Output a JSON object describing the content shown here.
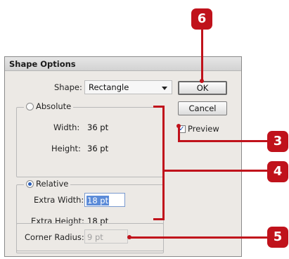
{
  "dialog": {
    "title": "Shape Options",
    "shape_label": "Shape:",
    "shape_value": "Rectangle",
    "ok_label": "OK",
    "cancel_label": "Cancel",
    "preview_label": "Preview",
    "preview_checked": true,
    "absolute": {
      "label": "Absolute",
      "width_label": "Width:",
      "width_value": "36 pt",
      "height_label": "Height:",
      "height_value": "36 pt"
    },
    "relative": {
      "label": "Relative",
      "extra_width_label": "Extra Width:",
      "extra_width_value": "18 pt",
      "extra_height_label": "Extra Height:",
      "extra_height_value": "18 pt"
    },
    "corner_radius_label": "Corner Radius:",
    "corner_radius_value": "9 pt"
  },
  "callouts": {
    "ok": "6",
    "preview": "3",
    "options": "4",
    "corner_radius": "5"
  },
  "colors": {
    "callout": "#c0121b",
    "selection": "#5b8bd8"
  }
}
